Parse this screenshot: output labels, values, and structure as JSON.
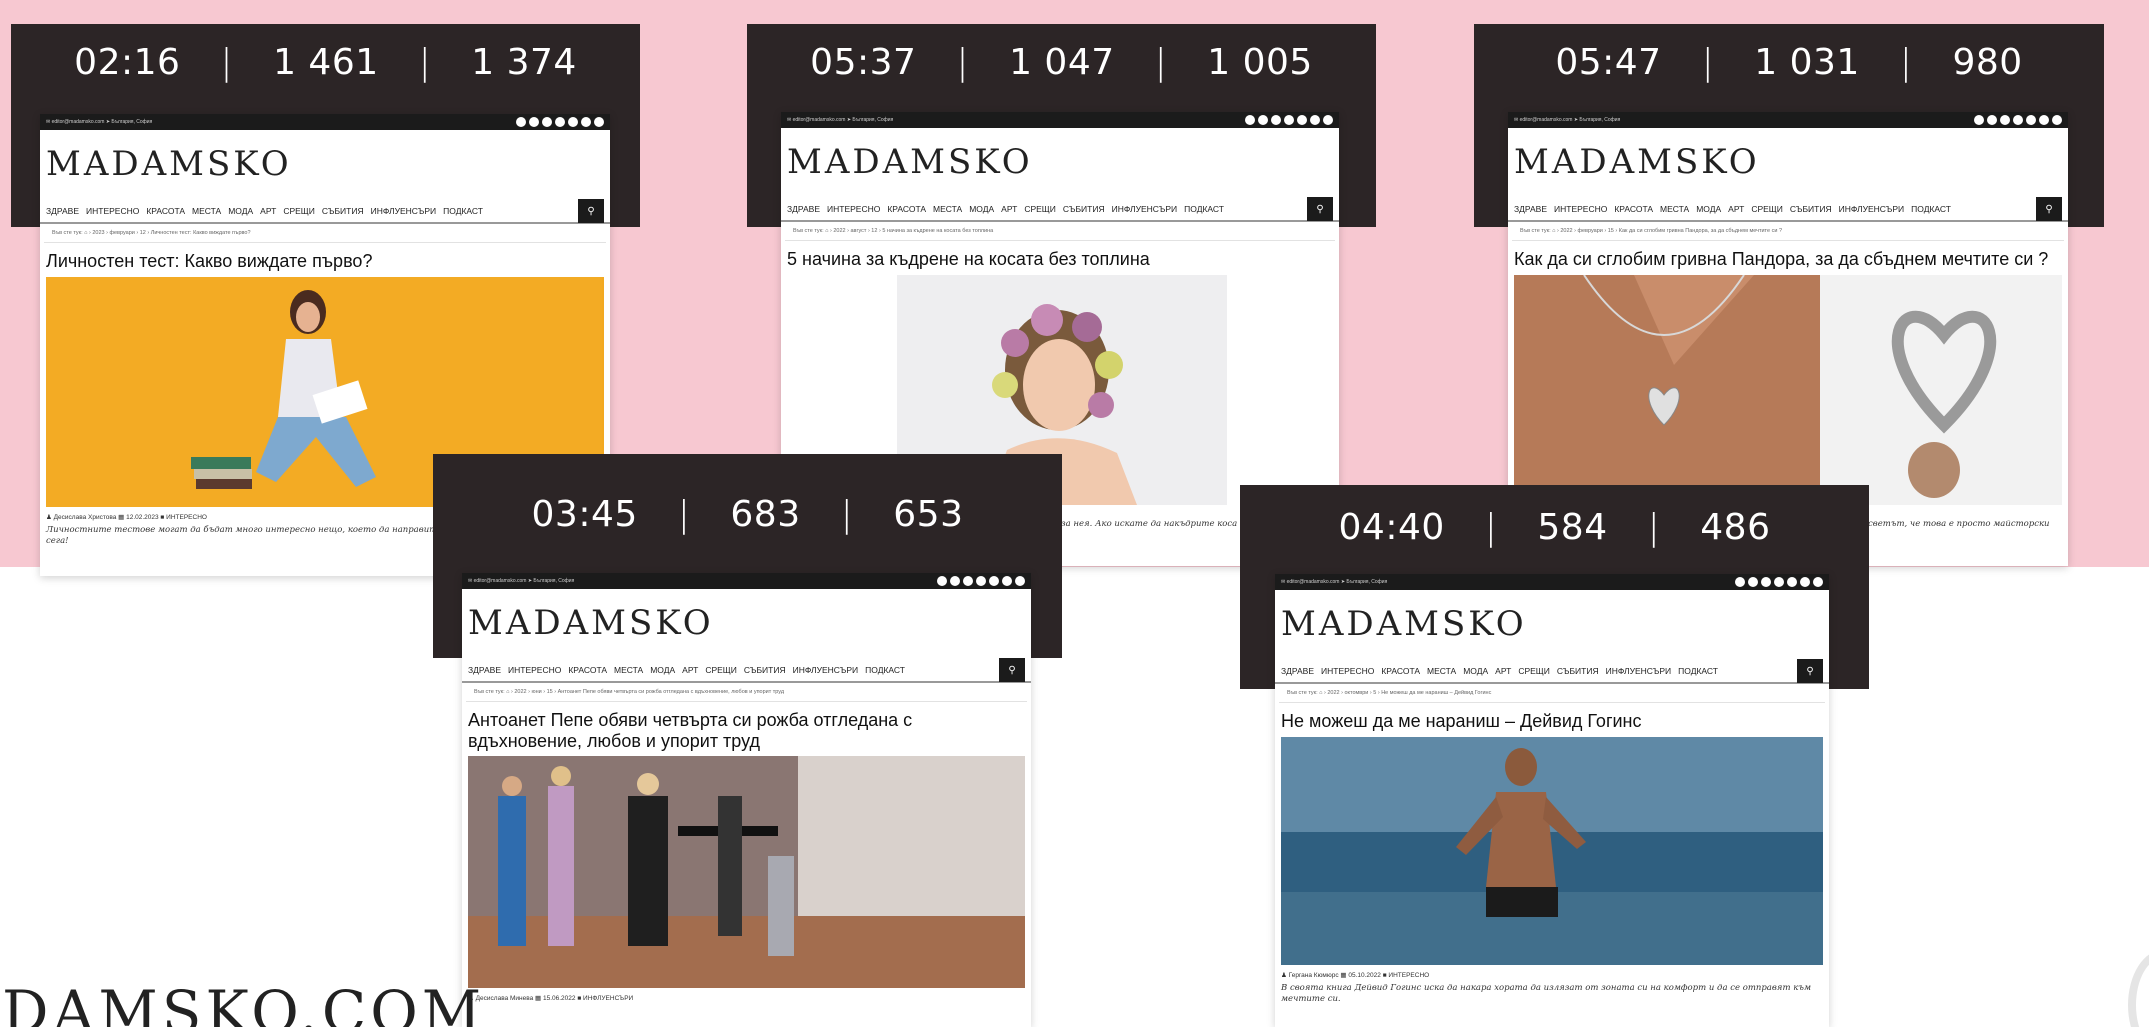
{
  "site": {
    "logo": "MADAMSKO",
    "topbar_left": "✉ editor@madamsko.com   ➤ България, София",
    "nav": [
      "ЗДРАВЕ",
      "ИНТЕРЕСНО",
      "КРАСОТА",
      "МЕСТА",
      "МОДА",
      "АРТ",
      "СРЕЩИ",
      "СЪБИТИЯ",
      "ИНФЛУЕНСЪРИ",
      "ПОДКАСТ"
    ],
    "search_icon": "search-icon",
    "footer_brand": "DAMSKO.COM"
  },
  "cards": [
    {
      "stats": {
        "time": "02:16",
        "views": "1 461",
        "reads": "1 374"
      },
      "breadcrumb": "Във сте тук: ⌂ › 2023 › февруари › 12 › Личностен тест: Какво виждате първо?",
      "title": "Личностен тест: Какво виждате първо?",
      "meta": "♟ Десислава Христова   ▦ 12.02.2023   ■ ИНТЕРЕСНО",
      "excerpt": "Личностните тестове могат да бъдат много интересно нещо, което да направите. Направете своя личностен тест сега!"
    },
    {
      "stats": {
        "time": "05:37",
        "views": "1 047",
        "reads": "1 005"
      },
      "breadcrumb": "Във сте тук: ⌂ › 2022 › август › 12 › 5 начина за къдрене на косата без топлина",
      "title": "5 начина за къдрене на косата без топлина",
      "excerpt_partial": "за нея. Ако искате да накъдрите коса"
    },
    {
      "stats": {
        "time": "05:47",
        "views": "1 031",
        "reads": "980"
      },
      "breadcrumb": "Във сте тук: ⌂ › 2022 › февруари › 15 › Как да си сглобим гривна Пандора, за да сбъднем мечтите си ?",
      "title": "Как да си сглобим гривна Пандора, за да сбъднем мечтите си ?",
      "excerpt_partial": "светът, че това е просто майсторски"
    },
    {
      "stats": {
        "time": "03:45",
        "views": "683",
        "reads": "653"
      },
      "breadcrumb": "Във сте тук: ⌂ › 2022 › юни › 15 › Антоанет Пепе обяви четвърта си рожба отгледана с вдъхновение, любов и упорит труд",
      "title": "Антоанет Пепе обяви четвърта си рожба отгледана с вдъхновение, любов и упорит труд",
      "meta": "♟ Десислава Минева   ▦ 15.06.2022   ■ ИНФЛУЕНСЪРИ"
    },
    {
      "stats": {
        "time": "04:40",
        "views": "584",
        "reads": "486"
      },
      "breadcrumb": "Във сте тук: ⌂ › 2022 › октомври › 5 › Не можеш да ме нараниш – Дейвид Гогинс",
      "title": "Не можеш да ме нараниш – Дейвид Гогинс",
      "meta": "♟ Гергана Кюмюрс   ▦ 05.10.2022   ■ ИНТЕРЕСНО",
      "excerpt": "В своята книга Дейвид Гогинс иска да накара хората да излязат от зоната си на комфорт и да се отправят към мечтите си."
    }
  ],
  "colors": {
    "pink": "#f7c8d1",
    "dark": "#2c2526"
  }
}
